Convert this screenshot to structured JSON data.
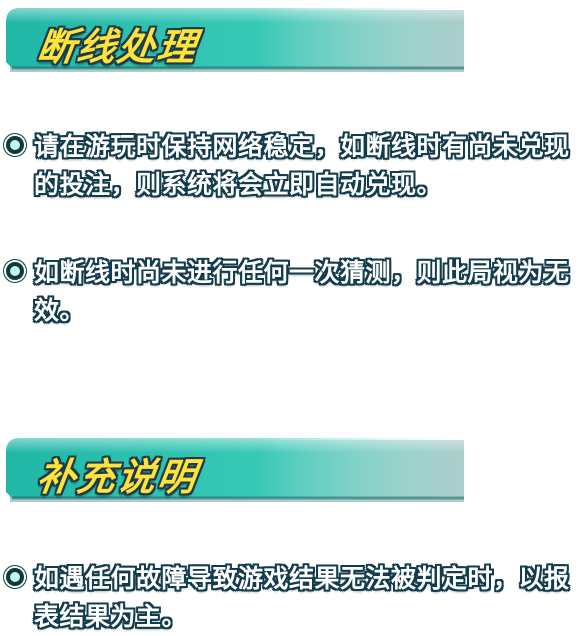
{
  "sections": [
    {
      "title": "断线处理",
      "items": [
        "请在游玩时保持网络稳定，如断线时有尚未兑现的投注，则系统将会立即自动兑现。",
        "如断线时尚未进行任何一次猜测，则此局视为无效。"
      ]
    },
    {
      "title": "补充说明",
      "items": [
        "如遇任何故障导致游戏结果无法被判定时，以报表结果为主。"
      ]
    }
  ],
  "colors": {
    "banner_teal": "#1fb7a6",
    "title_yellow": "#ffe23a",
    "outline_dark": "#123c4d",
    "bullet_dark": "#0d3b3a"
  },
  "icons": {
    "bullet": "ring-bullet-icon"
  }
}
